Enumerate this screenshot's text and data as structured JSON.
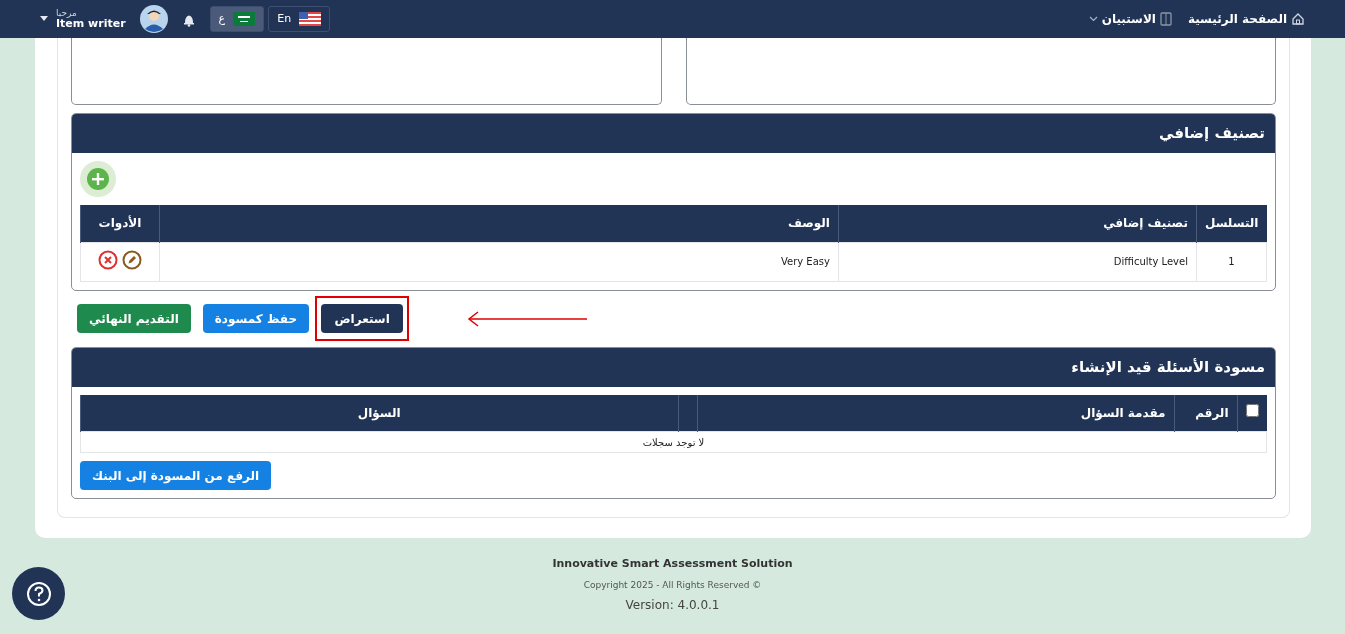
{
  "navbar": {
    "nav_items": [
      {
        "label": "الصفحة الرئيسية",
        "kind": "home"
      },
      {
        "label": "الاستبيان",
        "kind": "dropdown"
      }
    ],
    "languages": [
      {
        "label": "En",
        "kind": "english",
        "selected": false
      },
      {
        "label": "ع",
        "kind": "arabic",
        "selected": true
      }
    ],
    "user": {
      "greeting": "مرحبا",
      "role": "Item writer"
    }
  },
  "classification": {
    "title": "تصنيف إضافي",
    "columns": [
      "التسلسل",
      "تصنيف إضافي",
      "الوصف",
      "الأدوات"
    ],
    "rows": [
      {
        "cells": [
          "1",
          "Difficulty Level",
          "Very Easy"
        ]
      }
    ]
  },
  "actions": [
    {
      "label": "استعراض",
      "kind": "dark",
      "highlighted": true
    },
    {
      "label": "حفظ كمسودة",
      "kind": "primary",
      "highlighted": false
    },
    {
      "label": "التقديم النهائي",
      "kind": "success",
      "highlighted": false
    }
  ],
  "drafts": {
    "title": "مسودة الأسئلة قيد الإنشاء",
    "select_all_checked": false,
    "columns": [
      "الرقم",
      "مقدمة السؤال",
      "السؤال"
    ],
    "empty_message": "لا توجد سجلات",
    "upload_button": "الرفع من المسودة إلى البنك"
  },
  "footer": {
    "product": "Innovative Smart Assessment Solution",
    "copyright": "Copyright 2025 - All Rights Reserved ©",
    "version": "Version: 4.0.0.1"
  }
}
